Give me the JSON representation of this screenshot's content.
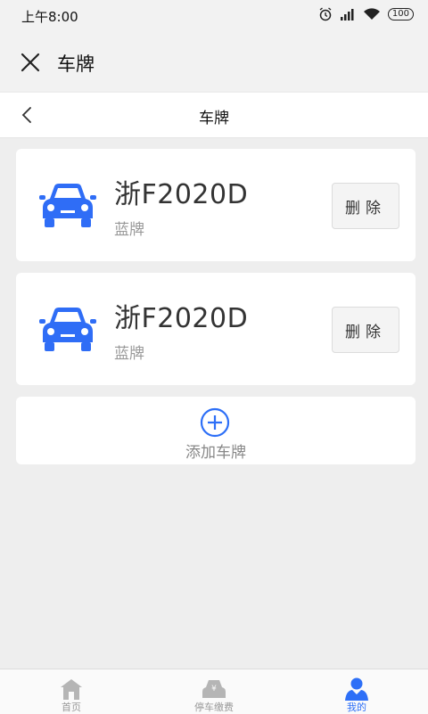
{
  "status_bar": {
    "time": "上午8:00",
    "battery": "100"
  },
  "app_bar": {
    "title": "车牌"
  },
  "nav_bar": {
    "title": "车牌"
  },
  "plates": [
    {
      "number": "浙F2020D",
      "type": "蓝牌",
      "delete_label": "删除"
    },
    {
      "number": "浙F2020D",
      "type": "蓝牌",
      "delete_label": "删除"
    }
  ],
  "add_button": {
    "label": "添加车牌"
  },
  "tabs": [
    {
      "label": "首页",
      "icon": "home-icon",
      "active": false
    },
    {
      "label": "停车缴费",
      "icon": "parking-fee-icon",
      "active": false
    },
    {
      "label": "我的",
      "icon": "user-icon",
      "active": true
    }
  ],
  "colors": {
    "accent": "#2d6ff7",
    "car": "#2f6df6"
  }
}
